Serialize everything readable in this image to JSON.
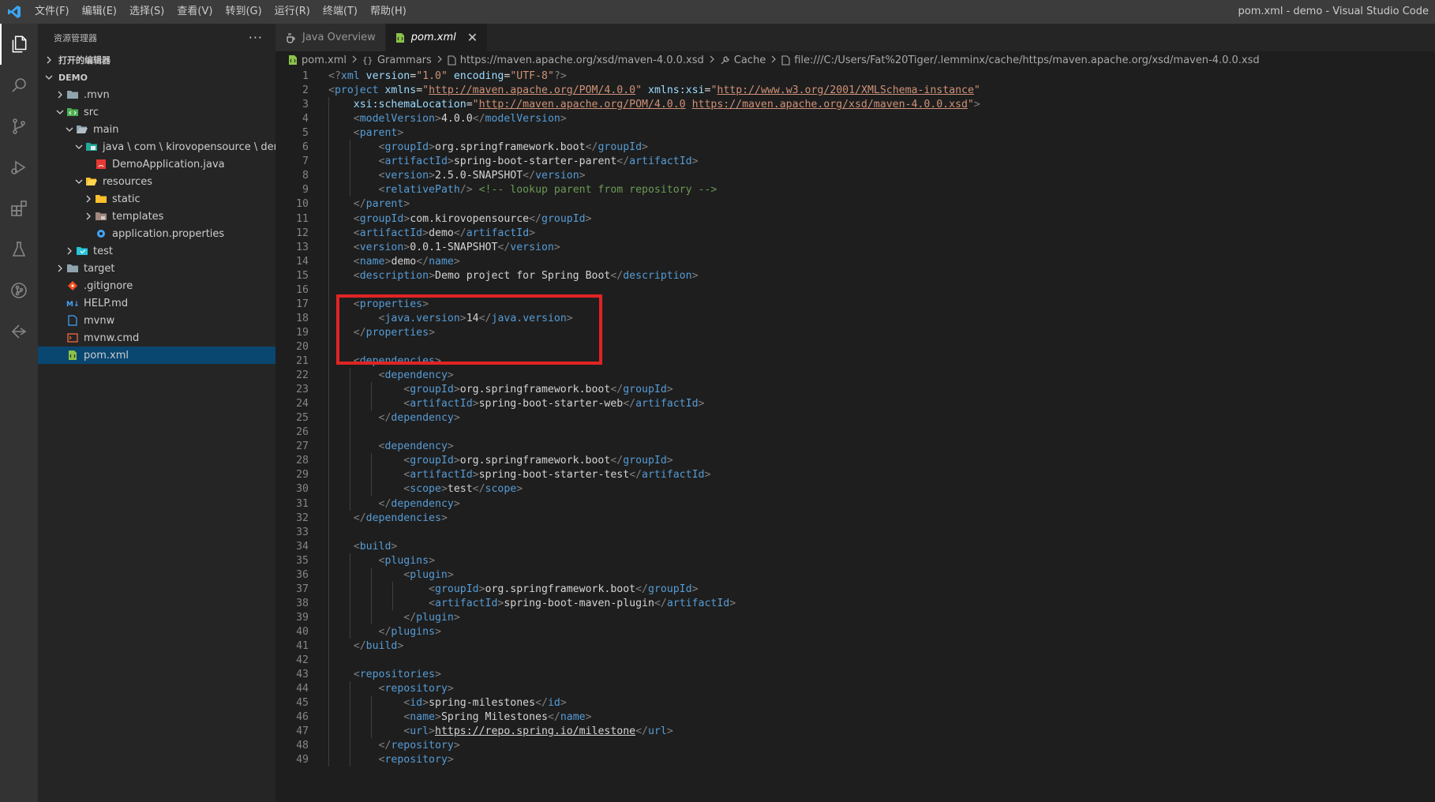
{
  "titlebar": {
    "menu": [
      "文件(F)",
      "编辑(E)",
      "选择(S)",
      "查看(V)",
      "转到(G)",
      "运行(R)",
      "终端(T)",
      "帮助(H)"
    ],
    "title": "pom.xml - demo - Visual Studio Code"
  },
  "activitybar": {
    "items": [
      "explorer-icon",
      "search-icon",
      "source-control-icon",
      "run-debug-icon",
      "extensions-icon",
      "testing-icon",
      "git-graph-icon",
      "remote-explorer-icon"
    ]
  },
  "sidebar": {
    "header": "资源管理器",
    "more": "···",
    "open_editors": "打开的编辑器",
    "root": "DEMO",
    "tree": [
      {
        "label": ".mvn",
        "depth": 1,
        "chev": "right",
        "icon": "folder-icon"
      },
      {
        "label": "src",
        "depth": 1,
        "chev": "down",
        "icon": "folder-src-icon"
      },
      {
        "label": "main",
        "depth": 2,
        "chev": "down",
        "icon": "folder-open-icon"
      },
      {
        "label": "java \\ com \\ kirovopensource \\ demo",
        "depth": 3,
        "chev": "down",
        "icon": "folder-java-icon"
      },
      {
        "label": "DemoApplication.java",
        "depth": 4,
        "chev": "",
        "icon": "java-file-icon"
      },
      {
        "label": "resources",
        "depth": 3,
        "chev": "down",
        "icon": "folder-resources-icon"
      },
      {
        "label": "static",
        "depth": 4,
        "chev": "right",
        "icon": "folder-static-icon"
      },
      {
        "label": "templates",
        "depth": 4,
        "chev": "right",
        "icon": "folder-templates-icon"
      },
      {
        "label": "application.properties",
        "depth": 4,
        "chev": "",
        "icon": "gear-file-icon"
      },
      {
        "label": "test",
        "depth": 2,
        "chev": "right",
        "icon": "folder-test-icon"
      },
      {
        "label": "target",
        "depth": 1,
        "chev": "right",
        "icon": "folder-icon"
      },
      {
        "label": ".gitignore",
        "depth": 1,
        "chev": "",
        "icon": "git-file-icon"
      },
      {
        "label": "HELP.md",
        "depth": 1,
        "chev": "",
        "icon": "markdown-file-icon"
      },
      {
        "label": "mvnw",
        "depth": 1,
        "chev": "",
        "icon": "plain-file-icon"
      },
      {
        "label": "mvnw.cmd",
        "depth": 1,
        "chev": "",
        "icon": "cmd-file-icon"
      },
      {
        "label": "pom.xml",
        "depth": 1,
        "chev": "",
        "icon": "xml-file-icon",
        "selected": true
      }
    ]
  },
  "tabs": [
    {
      "label": "Java Overview",
      "active": false,
      "icon": "java-overview-icon"
    },
    {
      "label": "pom.xml",
      "active": true,
      "icon": "xml-file-icon",
      "close": "✕"
    }
  ],
  "breadcrumbs": [
    {
      "label": "pom.xml",
      "icon": "xml-file-icon"
    },
    {
      "label": "Grammars",
      "icon": "braces-icon"
    },
    {
      "label": "https://maven.apache.org/xsd/maven-4.0.0.xsd",
      "icon": "file-icon"
    },
    {
      "label": "Cache",
      "icon": "wrench-icon"
    },
    {
      "label": "file:///C:/Users/Fat%20Tiger/.lemminx/cache/https/maven.apache.org/xsd/maven-4.0.0.xsd",
      "icon": "file-icon"
    }
  ],
  "editor": {
    "lines": [
      [
        [
          "b",
          "<?"
        ],
        [
          "tag",
          "xml"
        ],
        [
          "t",
          " "
        ],
        [
          "attr",
          "version"
        ],
        [
          "t",
          "="
        ],
        [
          "str",
          "\"1.0\""
        ],
        [
          "t",
          " "
        ],
        [
          "attr",
          "encoding"
        ],
        [
          "t",
          "="
        ],
        [
          "str",
          "\"UTF-8\""
        ],
        [
          "b",
          "?>"
        ]
      ],
      [
        [
          "b",
          "<"
        ],
        [
          "tag",
          "project"
        ],
        [
          "t",
          " "
        ],
        [
          "attr",
          "xmlns"
        ],
        [
          "t",
          "="
        ],
        [
          "str",
          "\""
        ],
        [
          "link",
          "http://maven.apache.org/POM/4.0.0"
        ],
        [
          "str",
          "\""
        ],
        [
          "t",
          " "
        ],
        [
          "attr",
          "xmlns:xsi"
        ],
        [
          "t",
          "="
        ],
        [
          "str",
          "\""
        ],
        [
          "link",
          "http://www.w3.org/2001/XMLSchema-instance"
        ],
        [
          "str",
          "\""
        ]
      ],
      [
        [
          "t",
          "    "
        ],
        [
          "attr",
          "xsi:schemaLocation"
        ],
        [
          "t",
          "="
        ],
        [
          "str",
          "\""
        ],
        [
          "link",
          "http://maven.apache.org/POM/4.0.0"
        ],
        [
          "str",
          " "
        ],
        [
          "link",
          "https://maven.apache.org/xsd/maven-4.0.0.xsd"
        ],
        [
          "str",
          "\""
        ],
        [
          "b",
          ">"
        ]
      ],
      [
        [
          "t",
          "    "
        ],
        [
          "b",
          "<"
        ],
        [
          "tag",
          "modelVersion"
        ],
        [
          "b",
          ">"
        ],
        [
          "t",
          "4.0.0"
        ],
        [
          "b",
          "</"
        ],
        [
          "tag",
          "modelVersion"
        ],
        [
          "b",
          ">"
        ]
      ],
      [
        [
          "t",
          "    "
        ],
        [
          "b",
          "<"
        ],
        [
          "tag",
          "parent"
        ],
        [
          "b",
          ">"
        ]
      ],
      [
        [
          "t",
          "        "
        ],
        [
          "b",
          "<"
        ],
        [
          "tag",
          "groupId"
        ],
        [
          "b",
          ">"
        ],
        [
          "t",
          "org.springframework.boot"
        ],
        [
          "b",
          "</"
        ],
        [
          "tag",
          "groupId"
        ],
        [
          "b",
          ">"
        ]
      ],
      [
        [
          "t",
          "        "
        ],
        [
          "b",
          "<"
        ],
        [
          "tag",
          "artifactId"
        ],
        [
          "b",
          ">"
        ],
        [
          "t",
          "spring-boot-starter-parent"
        ],
        [
          "b",
          "</"
        ],
        [
          "tag",
          "artifactId"
        ],
        [
          "b",
          ">"
        ]
      ],
      [
        [
          "t",
          "        "
        ],
        [
          "b",
          "<"
        ],
        [
          "tag",
          "version"
        ],
        [
          "b",
          ">"
        ],
        [
          "t",
          "2.5.0-SNAPSHOT"
        ],
        [
          "b",
          "</"
        ],
        [
          "tag",
          "version"
        ],
        [
          "b",
          ">"
        ]
      ],
      [
        [
          "t",
          "        "
        ],
        [
          "b",
          "<"
        ],
        [
          "tag",
          "relativePath"
        ],
        [
          "b",
          "/>"
        ],
        [
          "t",
          " "
        ],
        [
          "cmt",
          "<!-- lookup parent from repository -->"
        ]
      ],
      [
        [
          "t",
          "    "
        ],
        [
          "b",
          "</"
        ],
        [
          "tag",
          "parent"
        ],
        [
          "b",
          ">"
        ]
      ],
      [
        [
          "t",
          "    "
        ],
        [
          "b",
          "<"
        ],
        [
          "tag",
          "groupId"
        ],
        [
          "b",
          ">"
        ],
        [
          "t",
          "com.kirovopensource"
        ],
        [
          "b",
          "</"
        ],
        [
          "tag",
          "groupId"
        ],
        [
          "b",
          ">"
        ]
      ],
      [
        [
          "t",
          "    "
        ],
        [
          "b",
          "<"
        ],
        [
          "tag",
          "artifactId"
        ],
        [
          "b",
          ">"
        ],
        [
          "t",
          "demo"
        ],
        [
          "b",
          "</"
        ],
        [
          "tag",
          "artifactId"
        ],
        [
          "b",
          ">"
        ]
      ],
      [
        [
          "t",
          "    "
        ],
        [
          "b",
          "<"
        ],
        [
          "tag",
          "version"
        ],
        [
          "b",
          ">"
        ],
        [
          "t",
          "0.0.1-SNAPSHOT"
        ],
        [
          "b",
          "</"
        ],
        [
          "tag",
          "version"
        ],
        [
          "b",
          ">"
        ]
      ],
      [
        [
          "t",
          "    "
        ],
        [
          "b",
          "<"
        ],
        [
          "tag",
          "name"
        ],
        [
          "b",
          ">"
        ],
        [
          "t",
          "demo"
        ],
        [
          "b",
          "</"
        ],
        [
          "tag",
          "name"
        ],
        [
          "b",
          ">"
        ]
      ],
      [
        [
          "t",
          "    "
        ],
        [
          "b",
          "<"
        ],
        [
          "tag",
          "description"
        ],
        [
          "b",
          ">"
        ],
        [
          "t",
          "Demo project for Spring Boot"
        ],
        [
          "b",
          "</"
        ],
        [
          "tag",
          "description"
        ],
        [
          "b",
          ">"
        ]
      ],
      [],
      [
        [
          "t",
          "    "
        ],
        [
          "b",
          "<"
        ],
        [
          "tag",
          "properties"
        ],
        [
          "b",
          ">"
        ]
      ],
      [
        [
          "t",
          "        "
        ],
        [
          "b",
          "<"
        ],
        [
          "tag",
          "java.version"
        ],
        [
          "b",
          ">"
        ],
        [
          "t",
          "14"
        ],
        [
          "b",
          "</"
        ],
        [
          "tag",
          "java.version"
        ],
        [
          "b",
          ">"
        ]
      ],
      [
        [
          "t",
          "    "
        ],
        [
          "b",
          "</"
        ],
        [
          "tag",
          "properties"
        ],
        [
          "b",
          ">"
        ]
      ],
      [],
      [
        [
          "t",
          "    "
        ],
        [
          "b",
          "<"
        ],
        [
          "tag",
          "dependencies"
        ],
        [
          "b",
          ">"
        ]
      ],
      [
        [
          "t",
          "        "
        ],
        [
          "b",
          "<"
        ],
        [
          "tag",
          "dependency"
        ],
        [
          "b",
          ">"
        ]
      ],
      [
        [
          "t",
          "            "
        ],
        [
          "b",
          "<"
        ],
        [
          "tag",
          "groupId"
        ],
        [
          "b",
          ">"
        ],
        [
          "t",
          "org.springframework.boot"
        ],
        [
          "b",
          "</"
        ],
        [
          "tag",
          "groupId"
        ],
        [
          "b",
          ">"
        ]
      ],
      [
        [
          "t",
          "            "
        ],
        [
          "b",
          "<"
        ],
        [
          "tag",
          "artifactId"
        ],
        [
          "b",
          ">"
        ],
        [
          "t",
          "spring-boot-starter-web"
        ],
        [
          "b",
          "</"
        ],
        [
          "tag",
          "artifactId"
        ],
        [
          "b",
          ">"
        ]
      ],
      [
        [
          "t",
          "        "
        ],
        [
          "b",
          "</"
        ],
        [
          "tag",
          "dependency"
        ],
        [
          "b",
          ">"
        ]
      ],
      [],
      [
        [
          "t",
          "        "
        ],
        [
          "b",
          "<"
        ],
        [
          "tag",
          "dependency"
        ],
        [
          "b",
          ">"
        ]
      ],
      [
        [
          "t",
          "            "
        ],
        [
          "b",
          "<"
        ],
        [
          "tag",
          "groupId"
        ],
        [
          "b",
          ">"
        ],
        [
          "t",
          "org.springframework.boot"
        ],
        [
          "b",
          "</"
        ],
        [
          "tag",
          "groupId"
        ],
        [
          "b",
          ">"
        ]
      ],
      [
        [
          "t",
          "            "
        ],
        [
          "b",
          "<"
        ],
        [
          "tag",
          "artifactId"
        ],
        [
          "b",
          ">"
        ],
        [
          "t",
          "spring-boot-starter-test"
        ],
        [
          "b",
          "</"
        ],
        [
          "tag",
          "artifactId"
        ],
        [
          "b",
          ">"
        ]
      ],
      [
        [
          "t",
          "            "
        ],
        [
          "b",
          "<"
        ],
        [
          "tag",
          "scope"
        ],
        [
          "b",
          ">"
        ],
        [
          "t",
          "test"
        ],
        [
          "b",
          "</"
        ],
        [
          "tag",
          "scope"
        ],
        [
          "b",
          ">"
        ]
      ],
      [
        [
          "t",
          "        "
        ],
        [
          "b",
          "</"
        ],
        [
          "tag",
          "dependency"
        ],
        [
          "b",
          ">"
        ]
      ],
      [
        [
          "t",
          "    "
        ],
        [
          "b",
          "</"
        ],
        [
          "tag",
          "dependencies"
        ],
        [
          "b",
          ">"
        ]
      ],
      [],
      [
        [
          "t",
          "    "
        ],
        [
          "b",
          "<"
        ],
        [
          "tag",
          "build"
        ],
        [
          "b",
          ">"
        ]
      ],
      [
        [
          "t",
          "        "
        ],
        [
          "b",
          "<"
        ],
        [
          "tag",
          "plugins"
        ],
        [
          "b",
          ">"
        ]
      ],
      [
        [
          "t",
          "            "
        ],
        [
          "b",
          "<"
        ],
        [
          "tag",
          "plugin"
        ],
        [
          "b",
          ">"
        ]
      ],
      [
        [
          "t",
          "                "
        ],
        [
          "b",
          "<"
        ],
        [
          "tag",
          "groupId"
        ],
        [
          "b",
          ">"
        ],
        [
          "t",
          "org.springframework.boot"
        ],
        [
          "b",
          "</"
        ],
        [
          "tag",
          "groupId"
        ],
        [
          "b",
          ">"
        ]
      ],
      [
        [
          "t",
          "                "
        ],
        [
          "b",
          "<"
        ],
        [
          "tag",
          "artifactId"
        ],
        [
          "b",
          ">"
        ],
        [
          "t",
          "spring-boot-maven-plugin"
        ],
        [
          "b",
          "</"
        ],
        [
          "tag",
          "artifactId"
        ],
        [
          "b",
          ">"
        ]
      ],
      [
        [
          "t",
          "            "
        ],
        [
          "b",
          "</"
        ],
        [
          "tag",
          "plugin"
        ],
        [
          "b",
          ">"
        ]
      ],
      [
        [
          "t",
          "        "
        ],
        [
          "b",
          "</"
        ],
        [
          "tag",
          "plugins"
        ],
        [
          "b",
          ">"
        ]
      ],
      [
        [
          "t",
          "    "
        ],
        [
          "b",
          "</"
        ],
        [
          "tag",
          "build"
        ],
        [
          "b",
          ">"
        ]
      ],
      [],
      [
        [
          "t",
          "    "
        ],
        [
          "b",
          "<"
        ],
        [
          "tag",
          "repositories"
        ],
        [
          "b",
          ">"
        ]
      ],
      [
        [
          "t",
          "        "
        ],
        [
          "b",
          "<"
        ],
        [
          "tag",
          "repository"
        ],
        [
          "b",
          ">"
        ]
      ],
      [
        [
          "t",
          "            "
        ],
        [
          "b",
          "<"
        ],
        [
          "tag",
          "id"
        ],
        [
          "b",
          ">"
        ],
        [
          "t",
          "spring-milestones"
        ],
        [
          "b",
          "</"
        ],
        [
          "tag",
          "id"
        ],
        [
          "b",
          ">"
        ]
      ],
      [
        [
          "t",
          "            "
        ],
        [
          "b",
          "<"
        ],
        [
          "tag",
          "name"
        ],
        [
          "b",
          ">"
        ],
        [
          "t",
          "Spring Milestones"
        ],
        [
          "b",
          "</"
        ],
        [
          "tag",
          "name"
        ],
        [
          "b",
          ">"
        ]
      ],
      [
        [
          "t",
          "            "
        ],
        [
          "b",
          "<"
        ],
        [
          "tag",
          "url"
        ],
        [
          "b",
          ">"
        ],
        [
          "link2",
          "https://repo.spring.io/milestone"
        ],
        [
          "b",
          "</"
        ],
        [
          "tag",
          "url"
        ],
        [
          "b",
          ">"
        ]
      ],
      [
        [
          "t",
          "        "
        ],
        [
          "b",
          "</"
        ],
        [
          "tag",
          "repository"
        ],
        [
          "b",
          ">"
        ]
      ],
      [
        [
          "t",
          "        "
        ],
        [
          "b",
          "<"
        ],
        [
          "tag",
          "repository"
        ],
        [
          "b",
          ">"
        ]
      ]
    ]
  }
}
